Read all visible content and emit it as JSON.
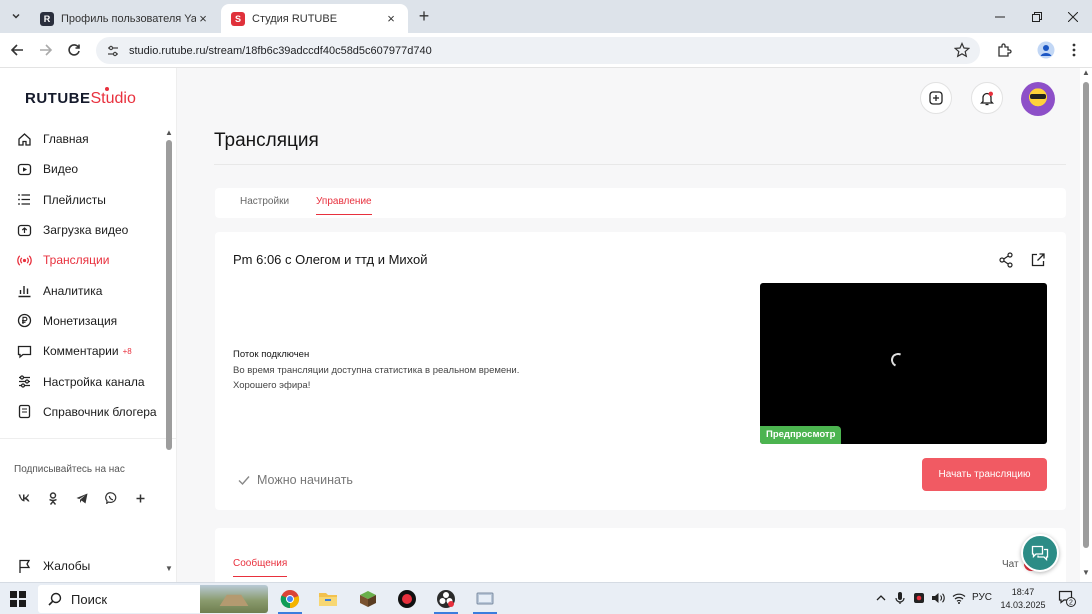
{
  "browser": {
    "tabs": [
      {
        "title": "Профиль пользователя Yan Ar",
        "favicon": "R",
        "active": false
      },
      {
        "title": "Студия RUTUBE",
        "favicon": "S",
        "active": true
      }
    ],
    "url": "studio.rutube.ru/stream/18fb6c39adccdf40c58d5c607977d740"
  },
  "logo": {
    "brand": "RUTUBE",
    "product": "Studio"
  },
  "sidebar": {
    "items": [
      {
        "label": "Главная",
        "icon": "home-icon"
      },
      {
        "label": "Видео",
        "icon": "video-icon"
      },
      {
        "label": "Плейлисты",
        "icon": "playlist-icon"
      },
      {
        "label": "Загрузка видео",
        "icon": "upload-icon"
      },
      {
        "label": "Трансляции",
        "icon": "broadcast-icon",
        "active": true
      },
      {
        "label": "Аналитика",
        "icon": "analytics-icon"
      },
      {
        "label": "Монетизация",
        "icon": "monetization-icon"
      },
      {
        "label": "Комментарии",
        "icon": "comments-icon",
        "badge": "+8"
      },
      {
        "label": "Настройка канала",
        "icon": "channel-settings-icon"
      },
      {
        "label": "Справочник блогера",
        "icon": "help-icon"
      }
    ],
    "follow_label": "Подписывайтесь на нас",
    "socials": [
      "vk-icon",
      "ok-icon",
      "telegram-icon",
      "viber-icon",
      "plus-icon"
    ],
    "complaints": "Жалобы"
  },
  "page": {
    "title": "Трансляция",
    "tabs": [
      {
        "label": "Настройки",
        "active": false
      },
      {
        "label": "Управление",
        "active": true
      }
    ],
    "stream": {
      "title": "Pm 6:06 с Олегом и ттд и Михой",
      "status_head": "Поток подключен",
      "status_lines": [
        "Во время трансляции доступна статистика в реальном времени.",
        "Хорошего эфира!"
      ],
      "preview_label": "Предпросмотр",
      "ready_label": "Можно начинать",
      "start_button": "Начать трансляцию"
    },
    "chat": {
      "messages_tab": "Сообщения",
      "chat_label": "Чат"
    }
  },
  "taskbar": {
    "search_label": "Поиск",
    "apps": [
      "chrome-icon",
      "file-explorer-icon",
      "minecraft-icon",
      "record-icon",
      "obs-icon",
      "app-icon"
    ],
    "language": "РУС",
    "time": "18:47",
    "date": "14.03.2025",
    "notification_count": "2"
  },
  "colors": {
    "accent": "#e8303d",
    "start_button": "#f15a63",
    "preview_badge": "#4cb450",
    "support_button": "#2c8c86"
  }
}
